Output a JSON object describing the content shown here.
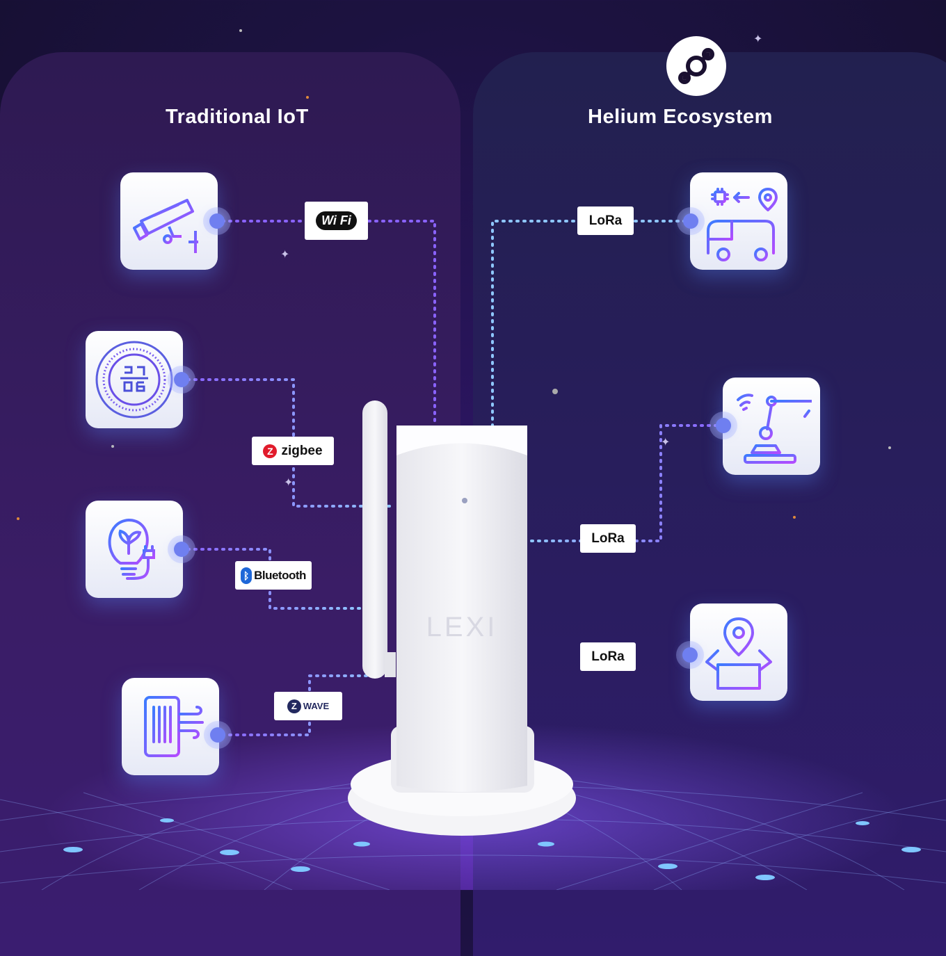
{
  "headings": {
    "left": "Traditional IoT",
    "right": "Helium Ecosystem"
  },
  "protocols": {
    "wifi": "Wi Fi",
    "zigbee": "zigbee",
    "bluetooth": "Bluetooth",
    "zwave": "WAVE",
    "lora_1": "LoRa",
    "lora_2": "LoRa",
    "lora_3": "LoRa"
  },
  "device_brand": "LEXI",
  "icons": {
    "left": [
      "security-camera-icon",
      "thermostat-icon",
      "smart-bulb-icon",
      "air-purifier-icon"
    ],
    "right": [
      "vehicle-tracking-icon",
      "industrial-robot-icon",
      "package-location-icon"
    ],
    "logo": "helium-logo-icon"
  },
  "colors": {
    "line_left": "#8a63ff",
    "line_mid": "#8fc7ff",
    "node": "#6f7ff0",
    "icon_gradient_start": "#3b7bff",
    "icon_gradient_end": "#b44bff"
  }
}
